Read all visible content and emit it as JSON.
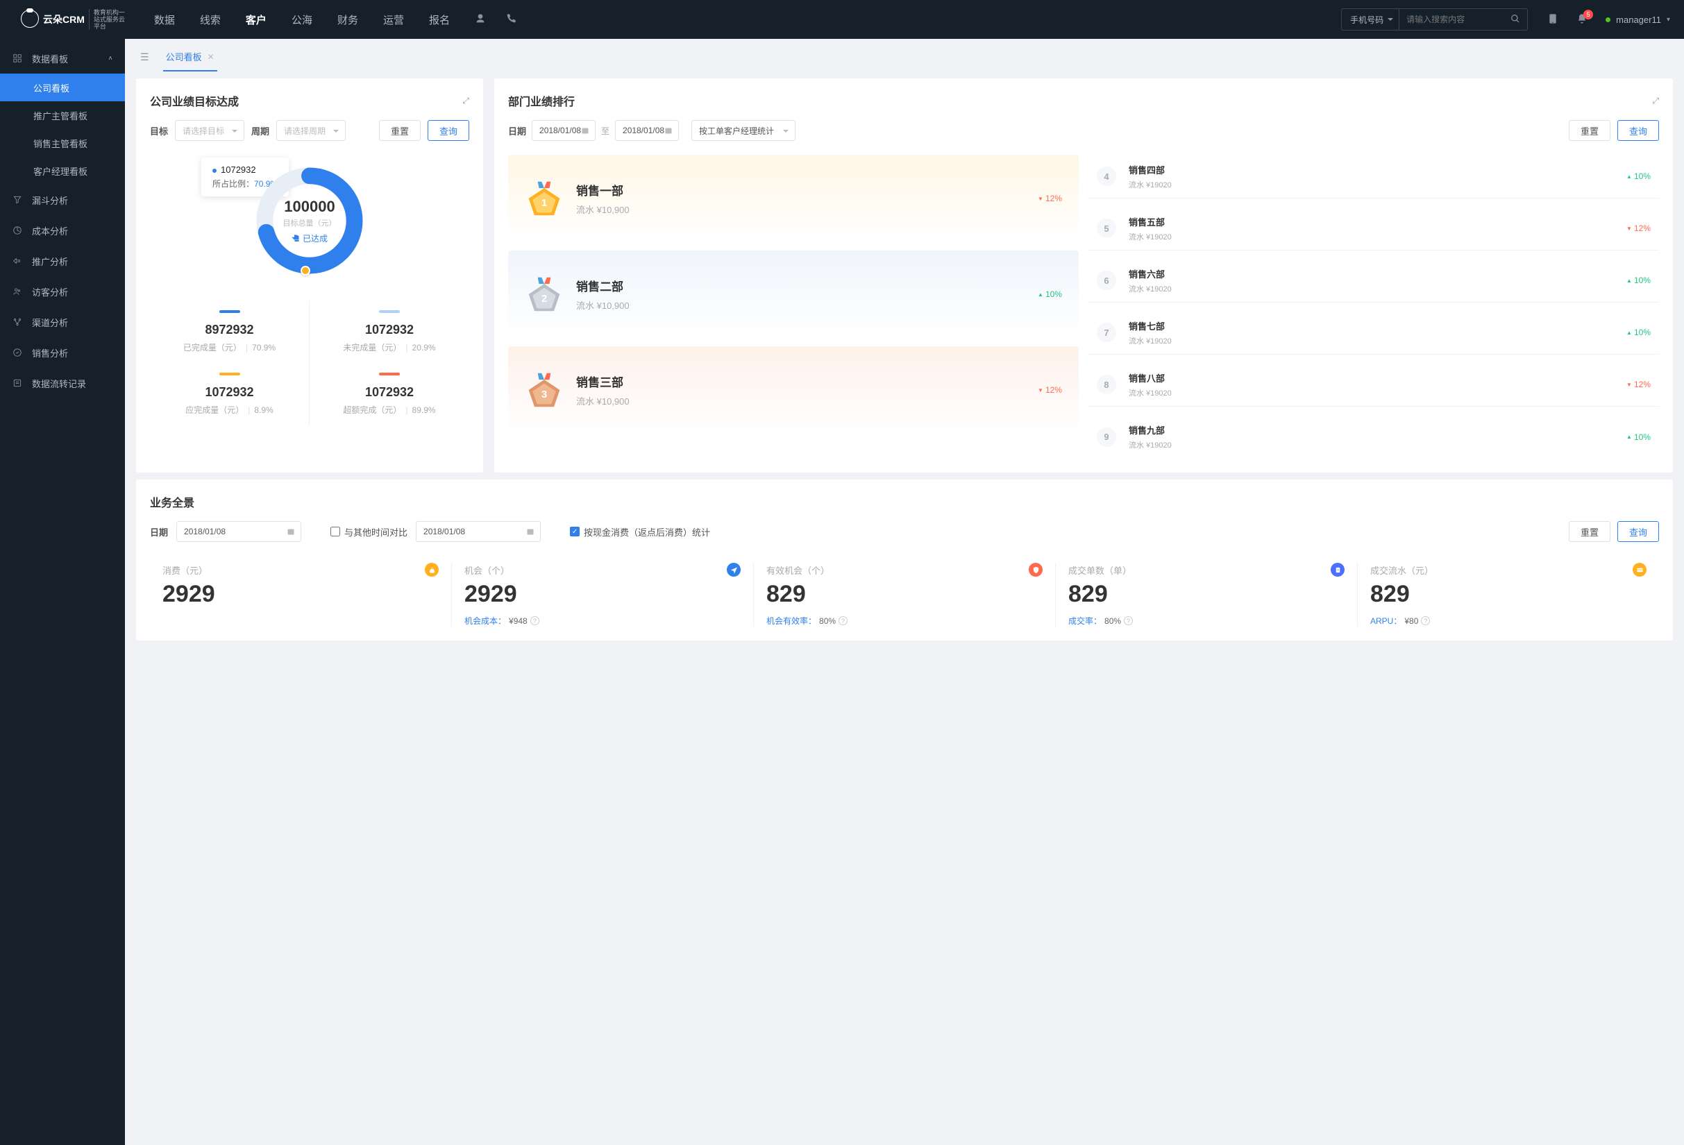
{
  "topbar": {
    "logo_main": "云朵CRM",
    "logo_sub": "教育机构一站式服务云平台",
    "nav": [
      "数据",
      "线索",
      "客户",
      "公海",
      "财务",
      "运营",
      "报名"
    ],
    "nav_active_index": 2,
    "search_type": "手机号码",
    "search_placeholder": "请输入搜索内容",
    "notif_count": "5",
    "username": "manager11"
  },
  "sidebar": {
    "group": "数据看板",
    "sub_items": [
      "公司看板",
      "推广主管看板",
      "销售主管看板",
      "客户经理看板"
    ],
    "active_sub": 0,
    "items": [
      "漏斗分析",
      "成本分析",
      "推广分析",
      "访客分析",
      "渠道分析",
      "销售分析",
      "数据流转记录"
    ]
  },
  "tabs": {
    "current": "公司看板"
  },
  "goals": {
    "title": "公司业绩目标达成",
    "target_label": "目标",
    "target_placeholder": "请选择目标",
    "period_label": "周期",
    "period_placeholder": "请选择周期",
    "btn_reset": "重置",
    "btn_query": "查询",
    "tooltip_value": "1072932",
    "tooltip_ratio_label": "所占比例：",
    "tooltip_ratio_value": "70.9%",
    "center_value": "100000",
    "center_label": "目标总量（元）",
    "center_status": "已达成",
    "stats": [
      {
        "color": "blue",
        "value": "8972932",
        "label": "已完成量（元）",
        "pct": "70.9%"
      },
      {
        "color": "lightblue",
        "value": "1072932",
        "label": "未完成量（元）",
        "pct": "20.9%"
      },
      {
        "color": "orange",
        "value": "1072932",
        "label": "应完成量（元）",
        "pct": "8.9%"
      },
      {
        "color": "red",
        "value": "1072932",
        "label": "超额完成（元）",
        "pct": "89.9%"
      }
    ]
  },
  "rankings": {
    "title": "部门业绩排行",
    "date_label": "日期",
    "date_from": "2018/01/08",
    "date_to": "2018/01/08",
    "date_sep": "至",
    "stat_type": "按工单客户经理统计",
    "btn_reset": "重置",
    "btn_query": "查询",
    "top3": [
      {
        "name": "销售一部",
        "sub": "流水 ¥10,900",
        "delta": "12%",
        "dir": "down"
      },
      {
        "name": "销售二部",
        "sub": "流水 ¥10,900",
        "delta": "10%",
        "dir": "up"
      },
      {
        "name": "销售三部",
        "sub": "流水 ¥10,900",
        "delta": "12%",
        "dir": "down"
      }
    ],
    "rest": [
      {
        "rank": "4",
        "name": "销售四部",
        "sub": "流水 ¥19020",
        "delta": "10%",
        "dir": "up"
      },
      {
        "rank": "5",
        "name": "销售五部",
        "sub": "流水 ¥19020",
        "delta": "12%",
        "dir": "down"
      },
      {
        "rank": "6",
        "name": "销售六部",
        "sub": "流水 ¥19020",
        "delta": "10%",
        "dir": "up"
      },
      {
        "rank": "7",
        "name": "销售七部",
        "sub": "流水 ¥19020",
        "delta": "10%",
        "dir": "up"
      },
      {
        "rank": "8",
        "name": "销售八部",
        "sub": "流水 ¥19020",
        "delta": "12%",
        "dir": "down"
      },
      {
        "rank": "9",
        "name": "销售九部",
        "sub": "流水 ¥19020",
        "delta": "10%",
        "dir": "up"
      }
    ]
  },
  "overview": {
    "title": "业务全景",
    "date_label": "日期",
    "date1": "2018/01/08",
    "compare_label": "与其他时间对比",
    "date2": "2018/01/08",
    "checked_label": "按现金消费（返点后消费）统计",
    "btn_reset": "重置",
    "btn_query": "查询",
    "metrics": [
      {
        "label": "消费（元）",
        "value": "2929",
        "foot": "",
        "foot_val": "",
        "badge_color": "#ffb020"
      },
      {
        "label": "机会（个）",
        "value": "2929",
        "foot": "机会成本：",
        "foot_val": "¥948",
        "badge_color": "#2f80ed"
      },
      {
        "label": "有效机会（个）",
        "value": "829",
        "foot": "机会有效率：",
        "foot_val": "80%",
        "badge_color": "#ff6a4d"
      },
      {
        "label": "成交单数（单）",
        "value": "829",
        "foot": "成交率：",
        "foot_val": "80%",
        "badge_color": "#4c6fff"
      },
      {
        "label": "成交流水（元）",
        "value": "829",
        "foot": "ARPU：",
        "foot_val": "¥80",
        "badge_color": "#ffb020"
      }
    ]
  }
}
